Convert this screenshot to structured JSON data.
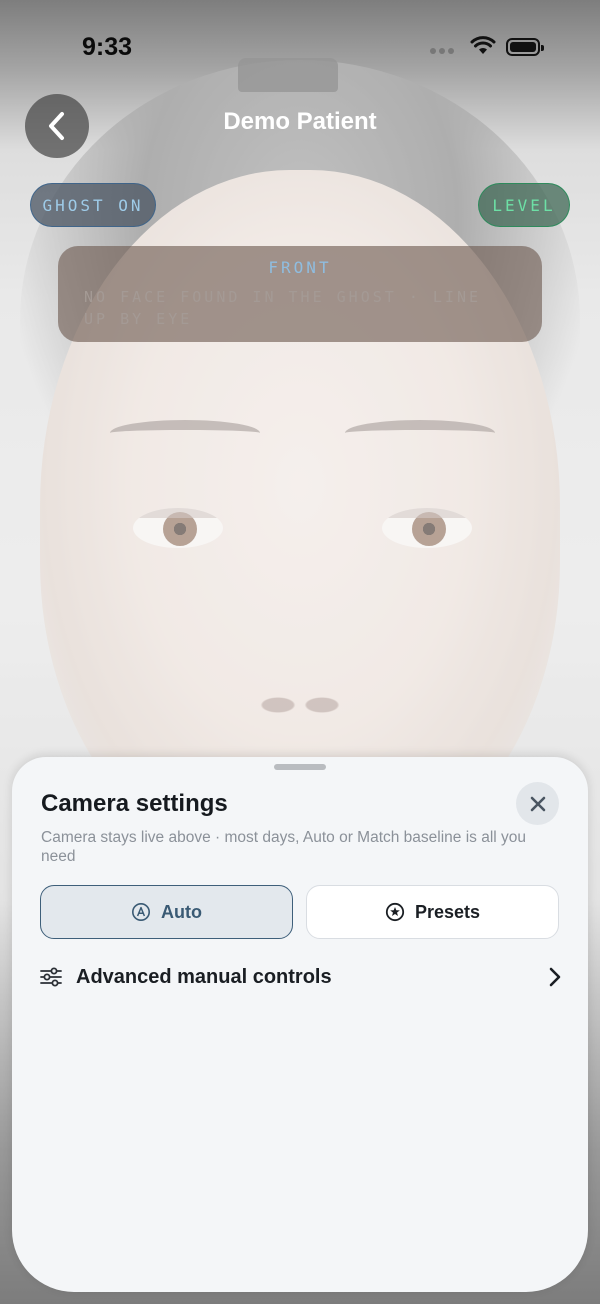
{
  "status_bar": {
    "time": "9:33"
  },
  "header": {
    "title": "Demo Patient",
    "back_icon": "chevron-left-icon"
  },
  "badges": {
    "ghost_label": "GHOST ON",
    "level_label": "LEVEL"
  },
  "info_card": {
    "heading": "FRONT",
    "message": "NO FACE FOUND IN THE GHOST · LINE UP BY EYE"
  },
  "sheet": {
    "title": "Camera settings",
    "subtitle": "Camera stays live above · most days, Auto or Match baseline is all you need",
    "close_icon": "close-icon",
    "segments": [
      {
        "label": "Auto",
        "icon": "auto-a-icon",
        "selected": true
      },
      {
        "label": "Presets",
        "icon": "star-circle-icon",
        "selected": false
      }
    ],
    "advanced": {
      "label": "Advanced manual controls",
      "icon": "sliders-icon"
    }
  },
  "colors": {
    "accent": "#3e5f7a",
    "ghost_text": "#9ecbe8",
    "level_text": "#6de0a6"
  }
}
